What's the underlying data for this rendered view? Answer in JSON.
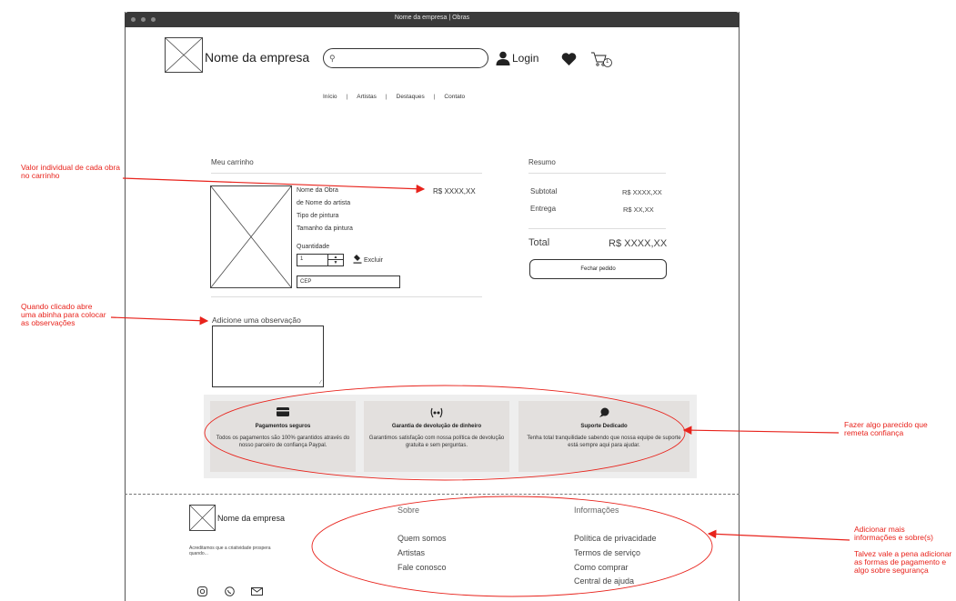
{
  "window": {
    "title": "Nome da empresa | Obras"
  },
  "header": {
    "company_name": "Nome da empresa",
    "login_label": "Login",
    "cart_count": "1",
    "nav": [
      "Início",
      "Artistas",
      "Destaques",
      "Contato"
    ],
    "separator": "|"
  },
  "cart": {
    "title": "Meu carrinho",
    "item": {
      "name": "Nome da Obra",
      "artist": "de Nome do artista",
      "type": "Tipo de pintura",
      "size": "Tamanho da pintura",
      "price": "R$ XXXX,XX",
      "quantity_label": "Quantidade",
      "quantity_value": "1",
      "delete_label": "Excluir",
      "cep_placeholder": "CEP"
    },
    "observation_label": "Adicione uma observação"
  },
  "summary": {
    "title": "Resumo",
    "subtotal_label": "Subtotal",
    "subtotal_value": "R$ XXXX,XX",
    "delivery_label": "Entrega",
    "delivery_value": "R$ XX,XX",
    "total_label": "Total",
    "total_value": "R$ XXXX,XX",
    "checkout_label": "Fechar pedido"
  },
  "trust": [
    {
      "icon": "credit-card-icon",
      "title": "Pagamentos seguros",
      "desc": "Todos os pagamentos são 100% garantidos através do nosso parceiro de confiança Paypal."
    },
    {
      "icon": "money-back-icon",
      "title": "Garantia de devolução de dinheiro",
      "desc": "Garantimos satisfação com nossa política de devolução gratuita e sem perguntas."
    },
    {
      "icon": "support-icon",
      "title": "Suporte Dedicado",
      "desc": "Tenha total tranquilidade sabendo que nossa equipe de suporte está sempre aqui para ajudar."
    }
  ],
  "footer": {
    "company_name": "Nome da empresa",
    "tagline": "Acreditamos que a criatividade prospera quando...",
    "about_title": "Sobre",
    "about_links": [
      "Quem somos",
      "Artistas",
      "Fale conosco"
    ],
    "info_title": "Informações",
    "info_links": [
      "Política de privacidade",
      "Termos de serviço",
      "Como comprar",
      "Central de ajuda"
    ]
  },
  "annotations": {
    "price_note": "Valor individual de cada obra no carrinho",
    "obs_note": "Quando clicado abre uma abinha para colocar as observações",
    "trust_note": "Fazer algo parecido que remeta confiança",
    "footer_note_1": "Adicionar mais informações e sobre(s)",
    "footer_note_2": "Talvez vale a pena adicionar as formas de pagamento e algo sobre segurança"
  },
  "colors": {
    "annotation": "#e8231c",
    "trust_bg": "#eeeeee",
    "card_bg": "#e3e0de",
    "titlebar": "#3a3a3a"
  }
}
